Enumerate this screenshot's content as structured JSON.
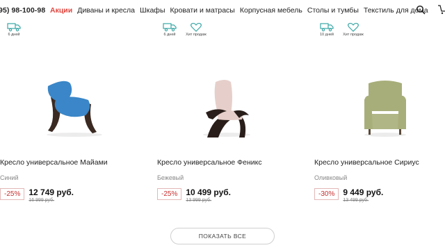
{
  "header": {
    "phone": "95) 98-100-98",
    "nav": [
      {
        "label": "Акции",
        "active": true
      },
      {
        "label": "Диваны и кресла"
      },
      {
        "label": "Шкафы"
      },
      {
        "label": "Кровати и матрасы"
      },
      {
        "label": "Корпусная мебель"
      },
      {
        "label": "Столы и тумбы"
      },
      {
        "label": "Текстиль для дома"
      }
    ],
    "icons": [
      "search-icon",
      "cart-icon"
    ]
  },
  "products": [
    {
      "delivery": "6 дней",
      "title": "Кресло универсальное Майами",
      "color": "Синий",
      "discount": "-25%",
      "price": "12 749 руб.",
      "old_price": "16 999 руб.",
      "seat_color": "#3a86c8"
    },
    {
      "delivery": "6 дней",
      "hit": "Хит продаж",
      "title": "Кресло универсальное Феникс",
      "color": "Бежевый",
      "discount": "-25%",
      "price": "10 499 руб.",
      "old_price": "13 999 руб.",
      "seat_color": "#e6cfca"
    },
    {
      "delivery": "10 дней",
      "hit": "Хит продаж",
      "title": "Кресло универсальное Сириус",
      "color": "Оливковый",
      "discount": "-30%",
      "price": "9 449 руб.",
      "old_price": "13 499 руб.",
      "seat_color": "#a8ae7a"
    }
  ],
  "show_all_label": "ПОКАЗАТЬ ВСЕ",
  "colors": {
    "accent": "#e0463f",
    "teal": "#3aa6a6"
  }
}
